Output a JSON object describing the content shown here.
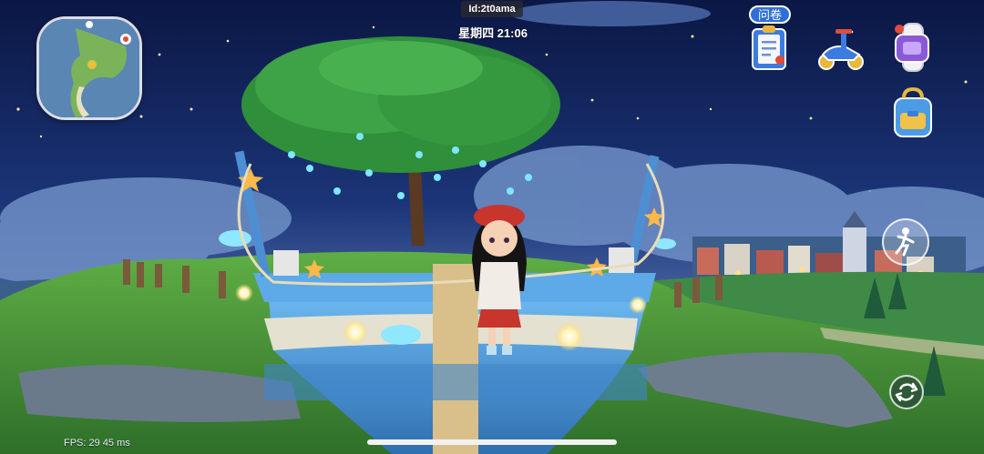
{
  "hud": {
    "player_id": "Id:2t0ama",
    "clock": "星期四 21:06",
    "survey_label": "问卷",
    "fps": "FPS: 29  45 ms"
  },
  "icons": {
    "minimap": "minimap-icon",
    "survey": "clipboard-icon",
    "scooter": "scooter-icon",
    "watch": "smartwatch-icon",
    "backpack": "backpack-icon",
    "emote": "running-person-icon",
    "swap": "swap-arrows-icon"
  },
  "colors": {
    "sky_top": "#0c1a45",
    "sky_mid": "#1d3a7a",
    "grass": "#4a9a3c",
    "boat_blue": "#4f9fe0",
    "tree_green": "#2f8f3a"
  }
}
